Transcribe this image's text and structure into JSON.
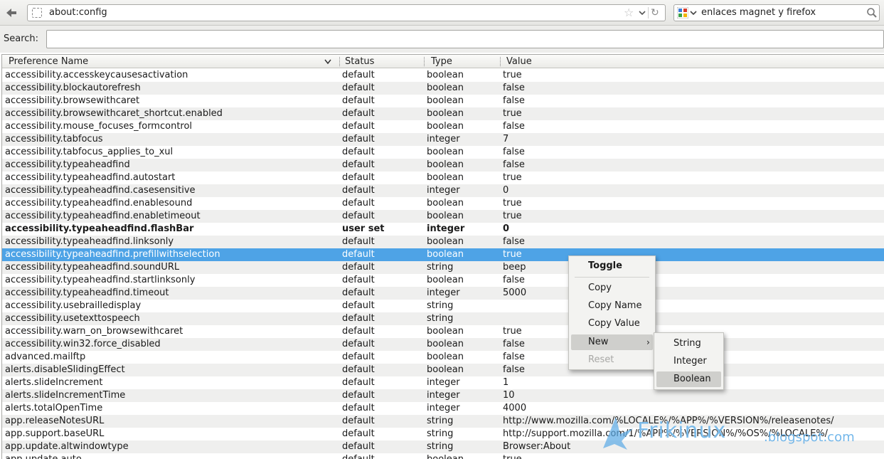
{
  "navbar": {
    "url": "about:config",
    "search_query": "enlaces magnet y firefox"
  },
  "filter": {
    "label": "Search:",
    "value": ""
  },
  "columns": {
    "name": "Preference Name",
    "status": "Status",
    "type": "Type",
    "value": "Value"
  },
  "rows": [
    {
      "name": "accessibility.accesskeycausesactivation",
      "status": "default",
      "type": "boolean",
      "value": "true"
    },
    {
      "name": "accessibility.blockautorefresh",
      "status": "default",
      "type": "boolean",
      "value": "false"
    },
    {
      "name": "accessibility.browsewithcaret",
      "status": "default",
      "type": "boolean",
      "value": "false"
    },
    {
      "name": "accessibility.browsewithcaret_shortcut.enabled",
      "status": "default",
      "type": "boolean",
      "value": "true"
    },
    {
      "name": "accessibility.mouse_focuses_formcontrol",
      "status": "default",
      "type": "boolean",
      "value": "false"
    },
    {
      "name": "accessibility.tabfocus",
      "status": "default",
      "type": "integer",
      "value": "7"
    },
    {
      "name": "accessibility.tabfocus_applies_to_xul",
      "status": "default",
      "type": "boolean",
      "value": "false"
    },
    {
      "name": "accessibility.typeaheadfind",
      "status": "default",
      "type": "boolean",
      "value": "false"
    },
    {
      "name": "accessibility.typeaheadfind.autostart",
      "status": "default",
      "type": "boolean",
      "value": "true"
    },
    {
      "name": "accessibility.typeaheadfind.casesensitive",
      "status": "default",
      "type": "integer",
      "value": "0"
    },
    {
      "name": "accessibility.typeaheadfind.enablesound",
      "status": "default",
      "type": "boolean",
      "value": "true"
    },
    {
      "name": "accessibility.typeaheadfind.enabletimeout",
      "status": "default",
      "type": "boolean",
      "value": "true"
    },
    {
      "name": "accessibility.typeaheadfind.flashBar",
      "status": "user set",
      "type": "integer",
      "value": "0",
      "userset": true
    },
    {
      "name": "accessibility.typeaheadfind.linksonly",
      "status": "default",
      "type": "boolean",
      "value": "false"
    },
    {
      "name": "accessibility.typeaheadfind.prefillwithselection",
      "status": "default",
      "type": "boolean",
      "value": "true",
      "selected": true
    },
    {
      "name": "accessibility.typeaheadfind.soundURL",
      "status": "default",
      "type": "string",
      "value": "beep"
    },
    {
      "name": "accessibility.typeaheadfind.startlinksonly",
      "status": "default",
      "type": "boolean",
      "value": "false"
    },
    {
      "name": "accessibility.typeaheadfind.timeout",
      "status": "default",
      "type": "integer",
      "value": "5000"
    },
    {
      "name": "accessibility.usebrailledisplay",
      "status": "default",
      "type": "string",
      "value": ""
    },
    {
      "name": "accessibility.usetexttospeech",
      "status": "default",
      "type": "string",
      "value": ""
    },
    {
      "name": "accessibility.warn_on_browsewithcaret",
      "status": "default",
      "type": "boolean",
      "value": "true"
    },
    {
      "name": "accessibility.win32.force_disabled",
      "status": "default",
      "type": "boolean",
      "value": "false"
    },
    {
      "name": "advanced.mailftp",
      "status": "default",
      "type": "boolean",
      "value": "false"
    },
    {
      "name": "alerts.disableSlidingEffect",
      "status": "default",
      "type": "boolean",
      "value": "false"
    },
    {
      "name": "alerts.slideIncrement",
      "status": "default",
      "type": "integer",
      "value": "1"
    },
    {
      "name": "alerts.slideIncrementTime",
      "status": "default",
      "type": "integer",
      "value": "10"
    },
    {
      "name": "alerts.totalOpenTime",
      "status": "default",
      "type": "integer",
      "value": "4000"
    },
    {
      "name": "app.releaseNotesURL",
      "status": "default",
      "type": "string",
      "value": "http://www.mozilla.com/%LOCALE%/%APP%/%VERSION%/releasenotes/"
    },
    {
      "name": "app.support.baseURL",
      "status": "default",
      "type": "string",
      "value": "http://support.mozilla.com/1/%APP%/%VERSION%/%OS%/%LOCALE%/"
    },
    {
      "name": "app.update.altwindowtype",
      "status": "default",
      "type": "string",
      "value": "Browser:About"
    },
    {
      "name": "app.update.auto",
      "status": "default",
      "type": "boolean",
      "value": "true"
    }
  ],
  "context_menu": {
    "toggle": "Toggle",
    "copy": "Copy",
    "copy_name": "Copy Name",
    "copy_value": "Copy Value",
    "new": "New",
    "reset": "Reset"
  },
  "new_submenu": {
    "string": "String",
    "integer": "Integer",
    "boolean": "Boolean"
  },
  "watermark": {
    "name": "Frikinux",
    "domain": ".blogspot.com"
  },
  "colors": {
    "selection": "#4ea3e6",
    "watermark": "#5aaae6"
  }
}
